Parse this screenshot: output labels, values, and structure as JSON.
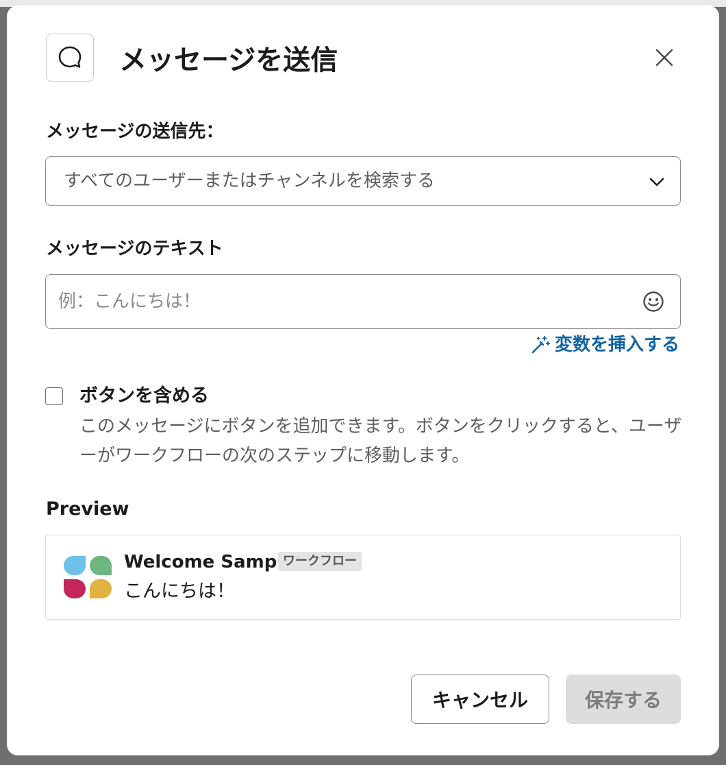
{
  "dialog": {
    "title": "メッセージを送信",
    "header_icon": "message-bubble-icon",
    "close_icon": "close-icon"
  },
  "recipient": {
    "label": "メッセージの送信先：",
    "placeholder": "すべてのユーザーまたはチャンネルを検索する",
    "chevron_icon": "chevron-down-icon"
  },
  "message_text": {
    "label": "メッセージのテキスト",
    "placeholder": "例：こんにちは！",
    "value": "",
    "emoji_icon": "emoji-icon"
  },
  "insert_variable": {
    "label": "変数を挿入する",
    "icon": "magic-wand-icon"
  },
  "include_button": {
    "label": "ボタンを含める",
    "checked": false,
    "description": "このメッセージにボタンを追加できます。ボタンをクリックすると、ユーザーがワークフローの次のステップに移動します。"
  },
  "preview": {
    "label": "Preview",
    "app_name": "Welcome Sample",
    "badge": "ワークフロー",
    "message": "こんにちは！"
  },
  "footer": {
    "cancel_label": "キャンセル",
    "save_label": "保存する"
  },
  "colors": {
    "link": "#1264a3",
    "logo_blue": "#6cc2ea",
    "logo_green": "#6fb582",
    "logo_red": "#c2265a",
    "logo_yellow": "#e0b23f",
    "save_disabled_bg": "#dddddd"
  }
}
